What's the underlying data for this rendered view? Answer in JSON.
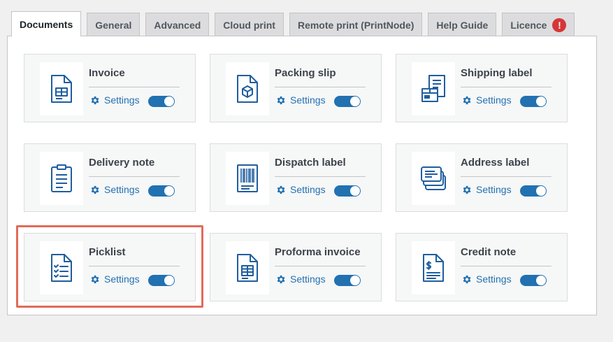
{
  "tabs": [
    {
      "label": "Documents",
      "active": true
    },
    {
      "label": "General",
      "active": false
    },
    {
      "label": "Advanced",
      "active": false
    },
    {
      "label": "Cloud print",
      "active": false
    },
    {
      "label": "Remote print (PrintNode)",
      "active": false
    },
    {
      "label": "Help Guide",
      "active": false
    },
    {
      "label": "Licence",
      "active": false,
      "alert": "!"
    }
  ],
  "cards": [
    {
      "title": "Invoice",
      "icon": "invoice-icon",
      "settings_label": "Settings",
      "enabled": true
    },
    {
      "title": "Packing slip",
      "icon": "packing-slip-icon",
      "settings_label": "Settings",
      "enabled": true
    },
    {
      "title": "Shipping label",
      "icon": "shipping-label-icon",
      "settings_label": "Settings",
      "enabled": true
    },
    {
      "title": "Delivery note",
      "icon": "delivery-note-icon",
      "settings_label": "Settings",
      "enabled": true
    },
    {
      "title": "Dispatch label",
      "icon": "dispatch-label-icon",
      "settings_label": "Settings",
      "enabled": true
    },
    {
      "title": "Address label",
      "icon": "address-label-icon",
      "settings_label": "Settings",
      "enabled": true
    },
    {
      "title": "Picklist",
      "icon": "picklist-icon",
      "settings_label": "Settings",
      "enabled": true,
      "highlighted": true
    },
    {
      "title": "Proforma invoice",
      "icon": "proforma-invoice-icon",
      "settings_label": "Settings",
      "enabled": true
    },
    {
      "title": "Credit note",
      "icon": "credit-note-icon",
      "settings_label": "Settings",
      "enabled": true
    }
  ],
  "colors": {
    "accent": "#2271b1",
    "icon": "#1f5e9e",
    "alert": "#d63638",
    "highlight": "#e26b5a"
  }
}
